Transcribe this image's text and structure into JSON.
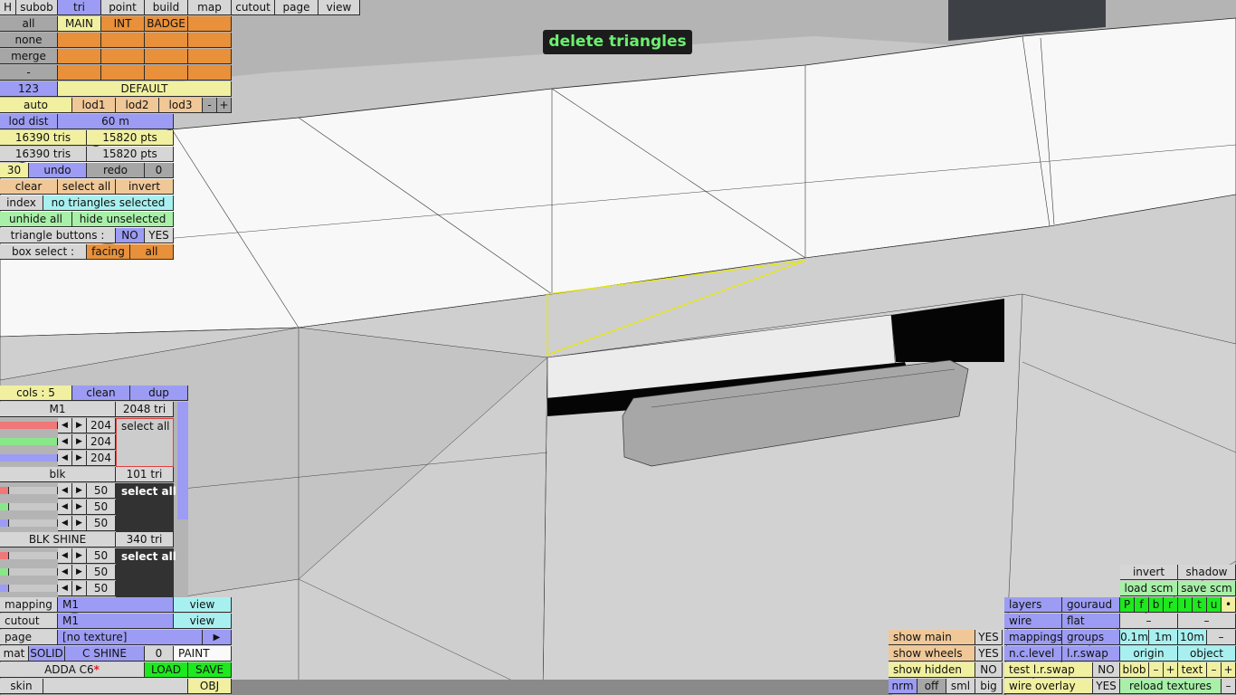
{
  "banner": "delete triangles",
  "menubar": [
    "H",
    "subob",
    "tri",
    "point",
    "build",
    "map",
    "cutout",
    "page",
    "view"
  ],
  "sel": {
    "all": "all",
    "none": "none",
    "merge": "merge",
    "dash": "-",
    "num": "123",
    "tags": [
      "MAIN",
      "INT",
      "BADGE"
    ],
    "default": "DEFAULT"
  },
  "lod": {
    "auto": "auto",
    "l1": "lod1",
    "l2": "lod2",
    "l3": "lod3",
    "minus": "-",
    "plus": "+",
    "dist_label": "lod dist",
    "dist_val": "60 m"
  },
  "stats": {
    "tris1": "16390 tris",
    "pts1": "15820 pts",
    "tris2": "16390 tris",
    "pts2": "15820 pts"
  },
  "undo": {
    "count": "30",
    "undo": "undo",
    "redo": "redo",
    "redo_count": "0"
  },
  "tri": {
    "clear": "clear",
    "select_all": "select all",
    "invert": "invert",
    "index": "index",
    "status": "no triangles selected",
    "unhide": "unhide all",
    "hide_unsel": "hide unselected",
    "buttons_label": "triangle buttons :",
    "no": "NO",
    "yes": "YES",
    "box_label": "box select :",
    "facing": "facing",
    "box_all": "all"
  },
  "cols": {
    "label": "cols : 5",
    "clean": "clean",
    "dup": "dup"
  },
  "materials": [
    {
      "name": "M1",
      "tri": "2048 tri",
      "r": "204",
      "g": "204",
      "b": "204",
      "select": "select all",
      "swatch": "#cccccc"
    },
    {
      "name": "blk",
      "tri": "101 tri",
      "r": "50",
      "g": "50",
      "b": "50",
      "select": "select all",
      "swatch": "#323232"
    },
    {
      "name": "BLK SHINE",
      "tri": "340 tri",
      "r": "50",
      "g": "50",
      "b": "50",
      "select": "select all",
      "swatch": "#323232"
    }
  ],
  "bottom_left": {
    "mapping": "mapping",
    "mapping_val": "M1",
    "view": "view",
    "cutout": "cutout",
    "cutout_val": "M1",
    "page": "page",
    "page_val": "[no texture]",
    "arrow": "▶",
    "mat": "mat",
    "solid": "SOLID",
    "cshine": "C SHINE",
    "zero": "0",
    "paint": "PAINT",
    "car": "ADDA C6",
    "star": "*",
    "load": "LOAD",
    "save": "SAVE",
    "skin": "skin",
    "obj": "OBJ"
  },
  "bottom_right": {
    "invert": "invert",
    "shadow": "shadow",
    "load_scm": "load scm",
    "save_scm": "save scm",
    "layers": "layers",
    "gouraud": "gouraud",
    "wire": "wire",
    "flat": "flat",
    "mappings": "mappings",
    "groups": "groups",
    "ncl": "n.c.level",
    "lrswap": "l.r.swap",
    "test_lr": "test l.r.swap",
    "test_no": "NO",
    "wire_overlay": "wire overlay",
    "wo_yes": "YES",
    "flags": [
      "P",
      "f",
      "b",
      "r",
      "l",
      "t",
      "u",
      "•"
    ],
    "dash1": "–",
    "dash2": "–",
    "dash3": "–",
    "s01": "0.1m",
    "s1": "1m",
    "s10": "10m",
    "sminus": "–",
    "origin": "origin",
    "object": "object",
    "blob": "blob",
    "bminus": "–",
    "bplus": "+",
    "text": "text",
    "tminus": "–",
    "tplus": "+",
    "reload": "reload textures",
    "rminus": "–",
    "show_main": "show main",
    "sm_yes": "YES",
    "show_wheels": "show wheels",
    "sw_yes": "YES",
    "show_hidden": "show hidden",
    "sh_no": "NO",
    "nrm": "nrm",
    "off": "off",
    "sml": "sml",
    "big": "big"
  }
}
